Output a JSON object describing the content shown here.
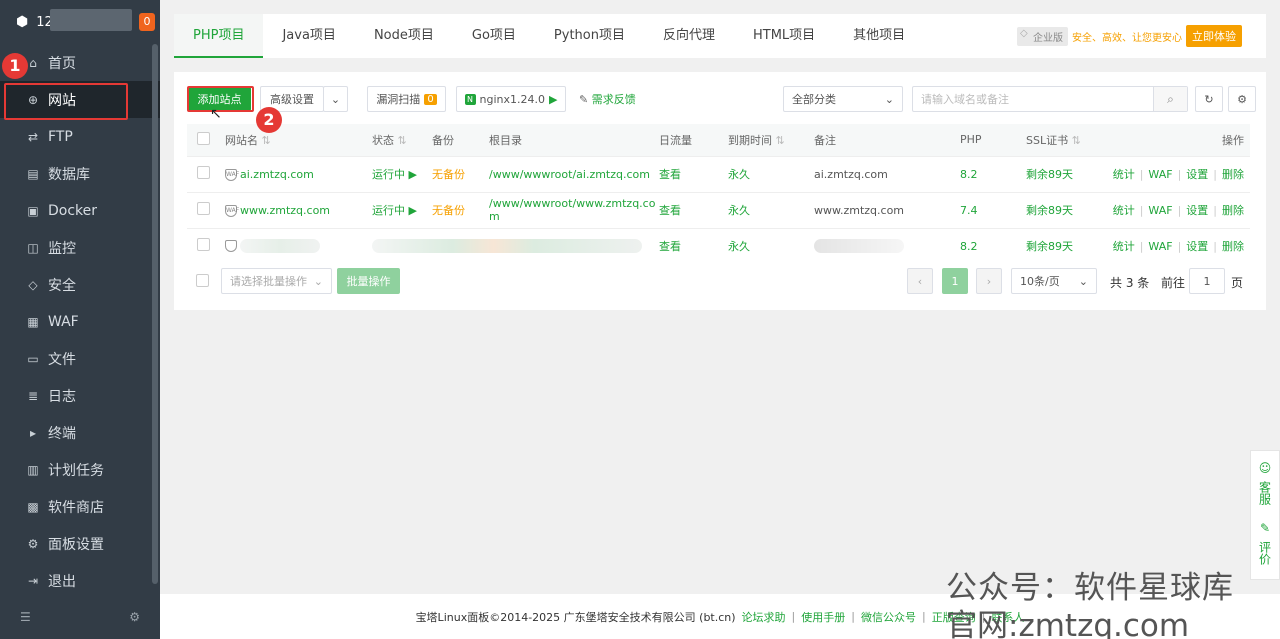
{
  "sidebar": {
    "ip_prefix": "12",
    "badge": "0",
    "items": [
      {
        "label": "首页",
        "icon": "home-icon"
      },
      {
        "label": "网站",
        "icon": "globe-icon"
      },
      {
        "label": "FTP",
        "icon": "ftp-icon"
      },
      {
        "label": "数据库",
        "icon": "database-icon"
      },
      {
        "label": "Docker",
        "icon": "docker-icon"
      },
      {
        "label": "监控",
        "icon": "monitor-icon"
      },
      {
        "label": "安全",
        "icon": "shield-icon"
      },
      {
        "label": "WAF",
        "icon": "waf-icon"
      },
      {
        "label": "文件",
        "icon": "folder-icon"
      },
      {
        "label": "日志",
        "icon": "log-icon"
      },
      {
        "label": "终端",
        "icon": "terminal-icon"
      },
      {
        "label": "计划任务",
        "icon": "calendar-icon"
      },
      {
        "label": "软件商店",
        "icon": "apps-icon"
      },
      {
        "label": "面板设置",
        "icon": "settings-icon"
      },
      {
        "label": "退出",
        "icon": "logout-icon"
      }
    ]
  },
  "callouts": {
    "one": "1",
    "two": "2"
  },
  "tabs": [
    "PHP项目",
    "Java项目",
    "Node项目",
    "Go项目",
    "Python项目",
    "反向代理",
    "HTML项目",
    "其他项目"
  ],
  "enterprise": {
    "tag": "企业版",
    "slogan": "安全、高效、让您更安心",
    "button": "立即体验"
  },
  "toolbar": {
    "add_site": "添加站点",
    "advanced": "高级设置",
    "scan": "漏洞扫描",
    "scan_badge": "0",
    "nginx": "nginx1.24.0",
    "feedback": "需求反馈",
    "category": "全部分类",
    "search_placeholder": "请输入域名或备注"
  },
  "table": {
    "headers": [
      "网站名",
      "状态",
      "备份",
      "根目录",
      "日流量",
      "到期时间",
      "备注",
      "PHP",
      "SSL证书",
      "操作"
    ],
    "rows": [
      {
        "name": "ai.zmtzq.com",
        "status": "运行中",
        "backup": "无备份",
        "root": "/www/wwwroot/ai.zmtzq.com",
        "traffic": "查看",
        "expire": "永久",
        "note": "ai.zmtzq.com",
        "php": "8.2",
        "ssl": "剩余89天"
      },
      {
        "name": "www.zmtzq.com",
        "status": "运行中",
        "backup": "无备份",
        "root": "/www/wwwroot/www.zmtzq.co",
        "root2": "m",
        "traffic": "查看",
        "expire": "永久",
        "note": "www.zmtzq.com",
        "php": "7.4",
        "ssl": "剩余89天"
      },
      {
        "name": "",
        "status": "",
        "backup": "",
        "root": "",
        "traffic": "查看",
        "expire": "永久",
        "note": "",
        "php": "8.2",
        "ssl": "剩余89天"
      }
    ],
    "actions": [
      "统计",
      "WAF",
      "设置",
      "删除"
    ]
  },
  "pager": {
    "batch_placeholder": "请选择批量操作",
    "batch_button": "批量操作",
    "page": "1",
    "per_page": "10条/页",
    "total": "共 3 条",
    "goto_label": "前往",
    "goto_value": "1",
    "page_suffix": "页"
  },
  "footer": {
    "copyright": "宝塔Linux面板©2014-2025 广东堡塔安全技术有限公司 (bt.cn)",
    "links": [
      "论坛求助",
      "使用手册",
      "微信公众号",
      "正版查询",
      "联系人"
    ]
  },
  "float": {
    "service": "客服",
    "review": "评价"
  },
  "watermark": {
    "line1": "公众号：软件星球库",
    "line2": "官网:zmtzq.com"
  }
}
